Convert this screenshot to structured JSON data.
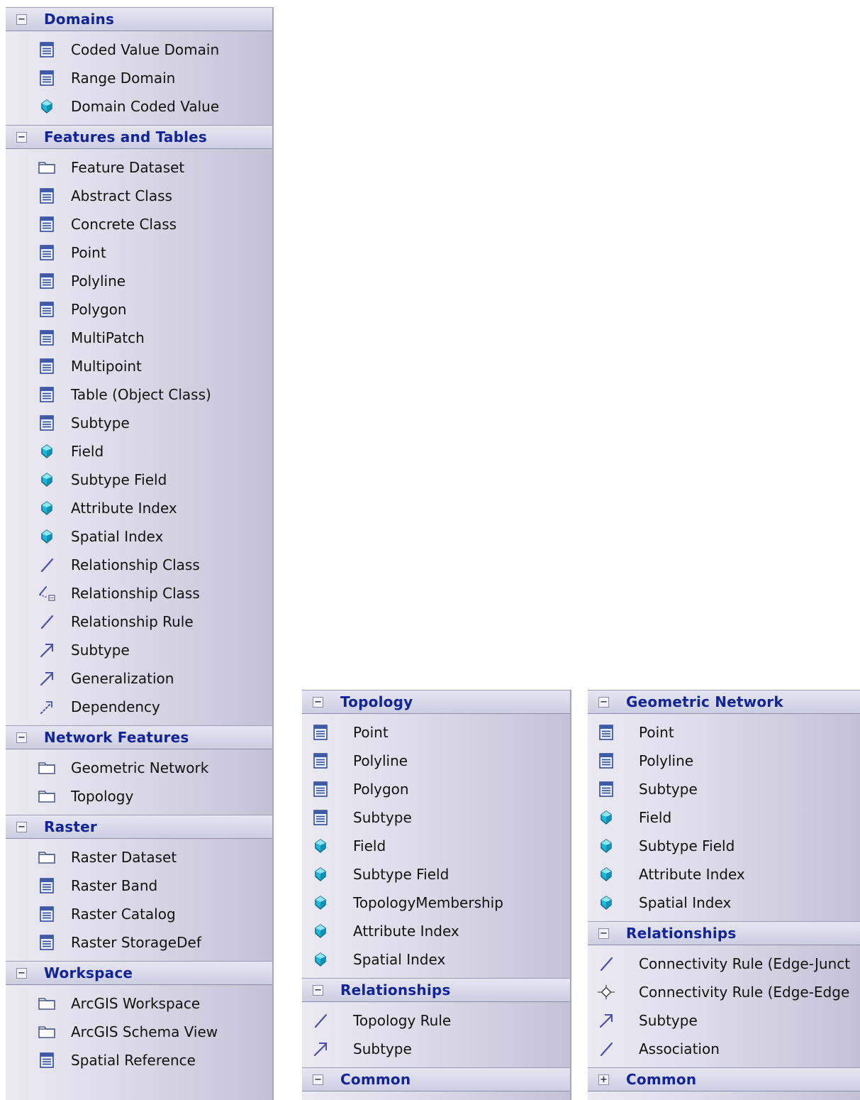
{
  "panels": [
    {
      "sections": [
        {
          "title": "Domains",
          "toggle": "−",
          "items": [
            {
              "label": "Coded Value Domain",
              "icon": "class-icon"
            },
            {
              "label": "Range Domain",
              "icon": "class-icon"
            },
            {
              "label": "Domain Coded Value",
              "icon": "field-icon"
            }
          ]
        },
        {
          "title": "Features and Tables",
          "toggle": "−",
          "items": [
            {
              "label": "Feature Dataset",
              "icon": "package-icon"
            },
            {
              "label": "Abstract Class",
              "icon": "class-icon"
            },
            {
              "label": "Concrete Class",
              "icon": "class-icon"
            },
            {
              "label": "Point",
              "icon": "class-icon"
            },
            {
              "label": "Polyline",
              "icon": "class-icon"
            },
            {
              "label": "Polygon",
              "icon": "class-icon"
            },
            {
              "label": "MultiPatch",
              "icon": "class-icon"
            },
            {
              "label": "Multipoint",
              "icon": "class-icon"
            },
            {
              "label": "Table (Object Class)",
              "icon": "class-icon"
            },
            {
              "label": "Subtype",
              "icon": "class-icon"
            },
            {
              "label": "Field",
              "icon": "field-icon"
            },
            {
              "label": "Subtype Field",
              "icon": "field-icon"
            },
            {
              "label": "Attribute Index",
              "icon": "field-icon"
            },
            {
              "label": "Spatial Index",
              "icon": "field-icon"
            },
            {
              "label": "Relationship Class",
              "icon": "association-icon"
            },
            {
              "label": "Relationship Class",
              "icon": "association-class-icon"
            },
            {
              "label": "Relationship Rule",
              "icon": "association-icon"
            },
            {
              "label": "Subtype",
              "icon": "generalization-icon"
            },
            {
              "label": "Generalization",
              "icon": "generalization-icon"
            },
            {
              "label": "Dependency",
              "icon": "dependency-icon"
            }
          ]
        },
        {
          "title": "Network Features",
          "toggle": "−",
          "items": [
            {
              "label": "Geometric Network",
              "icon": "package-icon"
            },
            {
              "label": "Topology",
              "icon": "package-icon"
            }
          ]
        },
        {
          "title": "Raster",
          "toggle": "−",
          "items": [
            {
              "label": "Raster Dataset",
              "icon": "package-icon"
            },
            {
              "label": "Raster Band",
              "icon": "class-icon"
            },
            {
              "label": "Raster Catalog",
              "icon": "class-icon"
            },
            {
              "label": "Raster StorageDef",
              "icon": "class-icon"
            }
          ]
        },
        {
          "title": "Workspace",
          "toggle": "−",
          "items": [
            {
              "label": "ArcGIS Workspace",
              "icon": "package-icon"
            },
            {
              "label": "ArcGIS Schema View",
              "icon": "package-icon"
            },
            {
              "label": "Spatial Reference",
              "icon": "class-icon"
            }
          ]
        }
      ]
    },
    {
      "sections": [
        {
          "title": "Topology",
          "toggle": "−",
          "items": [
            {
              "label": "Point",
              "icon": "class-icon"
            },
            {
              "label": "Polyline",
              "icon": "class-icon"
            },
            {
              "label": "Polygon",
              "icon": "class-icon"
            },
            {
              "label": "Subtype",
              "icon": "class-icon"
            },
            {
              "label": "Field",
              "icon": "field-icon"
            },
            {
              "label": "Subtype Field",
              "icon": "field-icon"
            },
            {
              "label": "TopologyMembership",
              "icon": "field-icon"
            },
            {
              "label": "Attribute Index",
              "icon": "field-icon"
            },
            {
              "label": "Spatial Index",
              "icon": "field-icon"
            }
          ]
        },
        {
          "title": "Relationships",
          "toggle": "−",
          "items": [
            {
              "label": "Topology Rule",
              "icon": "association-icon"
            },
            {
              "label": "Subtype",
              "icon": "generalization-icon"
            }
          ]
        },
        {
          "title": "Common",
          "toggle": "−",
          "items": []
        }
      ]
    },
    {
      "sections": [
        {
          "title": "Geometric Network",
          "toggle": "−",
          "items": [
            {
              "label": "Point",
              "icon": "class-icon"
            },
            {
              "label": "Polyline",
              "icon": "class-icon"
            },
            {
              "label": "Subtype",
              "icon": "class-icon"
            },
            {
              "label": "Field",
              "icon": "field-icon"
            },
            {
              "label": "Subtype Field",
              "icon": "field-icon"
            },
            {
              "label": "Attribute Index",
              "icon": "field-icon"
            },
            {
              "label": "Spatial Index",
              "icon": "field-icon"
            }
          ]
        },
        {
          "title": "Relationships",
          "toggle": "−",
          "items": [
            {
              "label": "Connectivity Rule (Edge-Junct",
              "icon": "association-icon"
            },
            {
              "label": "Connectivity Rule (Edge-Edge",
              "icon": "diamond-icon"
            },
            {
              "label": "Subtype",
              "icon": "generalization-icon"
            },
            {
              "label": "Association",
              "icon": "association-icon"
            }
          ]
        },
        {
          "title": "Common",
          "toggle": "+",
          "items": []
        }
      ]
    }
  ],
  "colors": {
    "header_text": "#10259a",
    "panel_bg": "#dcdae8",
    "field_icon": "#19b7d8",
    "class_icon": "#3e5ba8"
  }
}
